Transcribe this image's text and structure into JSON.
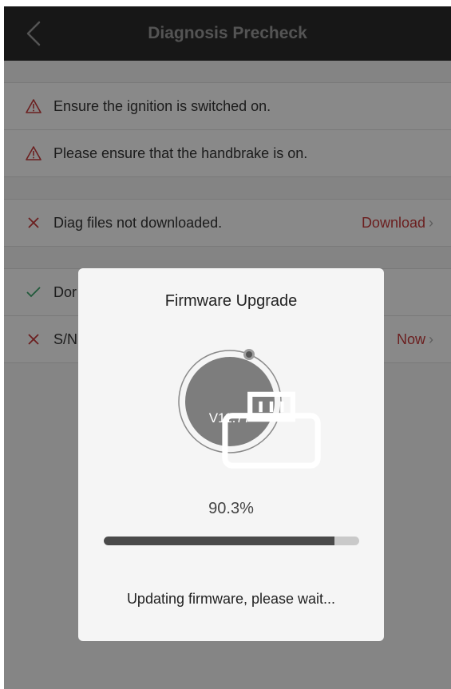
{
  "header": {
    "title": "Diagnosis Precheck"
  },
  "checks": [
    {
      "status": "warning",
      "text": "Ensure the ignition is switched on."
    },
    {
      "status": "warning",
      "text": "Please ensure that the handbrake is on."
    }
  ],
  "files_row": {
    "status": "error",
    "text": "Diag files not downloaded.",
    "action": "Download"
  },
  "rows_behind": [
    {
      "status": "ok",
      "text": "Dor"
    },
    {
      "status": "error",
      "text": "S/N",
      "action": "Now"
    }
  ],
  "dialog": {
    "title": "Firmware Upgrade",
    "version": "V11.77",
    "percent_text": "90.3%",
    "progress_fraction": 0.903,
    "status": "Updating firmware, please wait..."
  },
  "colors": {
    "header_bg": "#2b2b2b",
    "error": "#c4393a",
    "warning": "#c4393a",
    "ok": "#3aa26a",
    "progress_fill": "#4a4a4a"
  },
  "icons": {
    "back": "chevron-left-icon",
    "warning": "warning-triangle-icon",
    "error": "cross-icon",
    "ok": "checkmark-icon",
    "device": "obd-device-icon"
  }
}
